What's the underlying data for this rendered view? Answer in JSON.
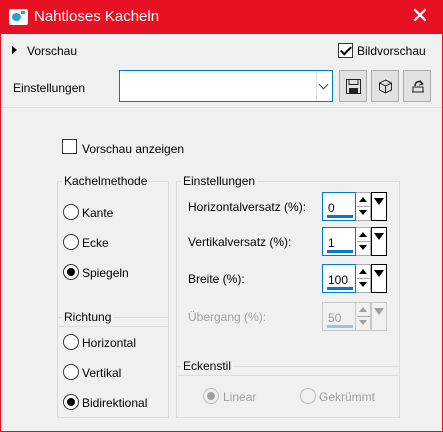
{
  "window": {
    "title": "Nahtloses Kacheln"
  },
  "preview_header": {
    "label": "Vorschau",
    "bild_label": "Bildvorschau",
    "bild_checked": true
  },
  "settings_row": {
    "label": "Einstellungen",
    "value": ""
  },
  "show_preview": {
    "label": "Vorschau anzeigen",
    "checked": false
  },
  "tiling_method": {
    "title": "Kachelmethode",
    "options": [
      {
        "label": "Kante",
        "selected": false
      },
      {
        "label": "Ecke",
        "selected": false
      },
      {
        "label": "Spiegeln",
        "selected": true
      }
    ]
  },
  "direction": {
    "title": "Richtung",
    "options": [
      {
        "label": "Horizontal",
        "selected": false
      },
      {
        "label": "Vertikal",
        "selected": false
      },
      {
        "label": "Bidirektional",
        "selected": true
      }
    ]
  },
  "settings_group": {
    "title": "Einstellungen",
    "fields": [
      {
        "label": "Horizontalversatz (%):",
        "value": "0",
        "enabled": true
      },
      {
        "label": "Vertikalversatz (%):",
        "value": "1",
        "enabled": true
      },
      {
        "label": "Breite (%):",
        "value": "100",
        "enabled": true
      },
      {
        "label": "Übergang (%):",
        "value": "50",
        "enabled": false
      }
    ]
  },
  "corner_style": {
    "title": "Eckenstil",
    "enabled": false,
    "options": [
      {
        "label": "Linear",
        "selected": true
      },
      {
        "label": "Gekrümmt",
        "selected": false
      }
    ]
  },
  "colors": {
    "titlebar": "#e81123",
    "accent": "#0078d7",
    "background": "#f0f0f0"
  },
  "icons": [
    "camera-icon",
    "close-icon",
    "save-icon",
    "cube-icon",
    "reset-icon"
  ]
}
